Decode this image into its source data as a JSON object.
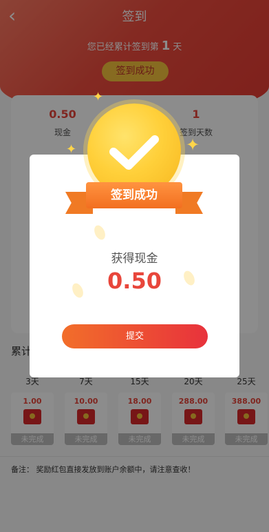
{
  "nav": {
    "back_icon": "‹",
    "title": "签到"
  },
  "summary": {
    "prefix": "您已经累计签到第",
    "days": "1",
    "suffix": "天"
  },
  "signed_button": "签到成功",
  "stats": [
    {
      "value": "0.50",
      "label": "现金"
    },
    {
      "value": "1",
      "label": "签到天数"
    }
  ],
  "section_title": "累计",
  "rewards": [
    {
      "day": "3天",
      "amount": "1.00",
      "status": "未完成"
    },
    {
      "day": "7天",
      "amount": "10.00",
      "status": "未完成"
    },
    {
      "day": "15天",
      "amount": "18.00",
      "status": "未完成"
    },
    {
      "day": "20天",
      "amount": "288.00",
      "status": "未完成"
    },
    {
      "day": "25天",
      "amount": "388.00",
      "status": "未完成"
    }
  ],
  "note": "备注：  奖励红包直接发放到账户余额中，请注意查收！",
  "modal": {
    "ribbon_title": "签到成功",
    "reward_label": "获得现金",
    "reward_amount": "0.50",
    "submit_label": "提交"
  },
  "colors": {
    "accent": "#e8463b",
    "gold": "#ffd03a",
    "ribbon": "#f26f20"
  }
}
